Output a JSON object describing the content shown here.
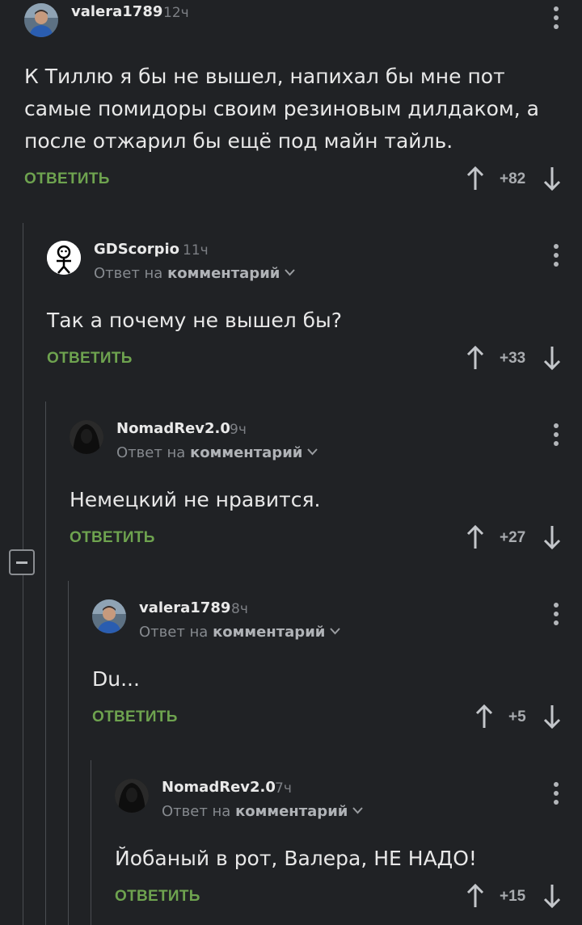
{
  "comments": [
    {
      "username": "valera1789",
      "time": "12ч",
      "text": "К Тиллю я бы не вышел, напихал бы мне пот самые помидоры своим резиновым дилдаком, а после отжарил бы ещё под майн тайль.",
      "reply_label": "ОТВЕТИТЬ",
      "rating": "+82"
    },
    {
      "username": "GDScorpio",
      "time": "11ч",
      "reply_prefix": "Ответ на",
      "reply_target": "комментарий",
      "text": "Так а почему не вышел бы?",
      "reply_label": "ОТВЕТИТЬ",
      "rating": "+33"
    },
    {
      "username": "NomadRev2.0",
      "time": "9ч",
      "reply_prefix": "Ответ на",
      "reply_target": "комментарий",
      "text": "Немецкий не нравится.",
      "reply_label": "ОТВЕТИТЬ",
      "rating": "+27"
    },
    {
      "username": "valera1789",
      "time": "8ч",
      "reply_prefix": "Ответ на",
      "reply_target": "комментарий",
      "text": "Du...",
      "reply_label": "ОТВЕТИТЬ",
      "rating": "+5"
    },
    {
      "username": "NomadRev2.0",
      "time": "7ч",
      "reply_prefix": "Ответ на",
      "reply_target": "комментарий",
      "text": "Йобаный в рот, Валера, НЕ НАДО!",
      "reply_label": "ОТВЕТИТЬ",
      "rating": "+15"
    }
  ],
  "colors": {
    "background": "#202225",
    "reply_green": "#6ea34f",
    "thread_line": "#4a4d52"
  },
  "icons": {
    "collapse": "minus-square-icon",
    "upvote": "arrow-up-icon",
    "downvote": "arrow-down-icon",
    "more": "vertical-dots-icon"
  }
}
